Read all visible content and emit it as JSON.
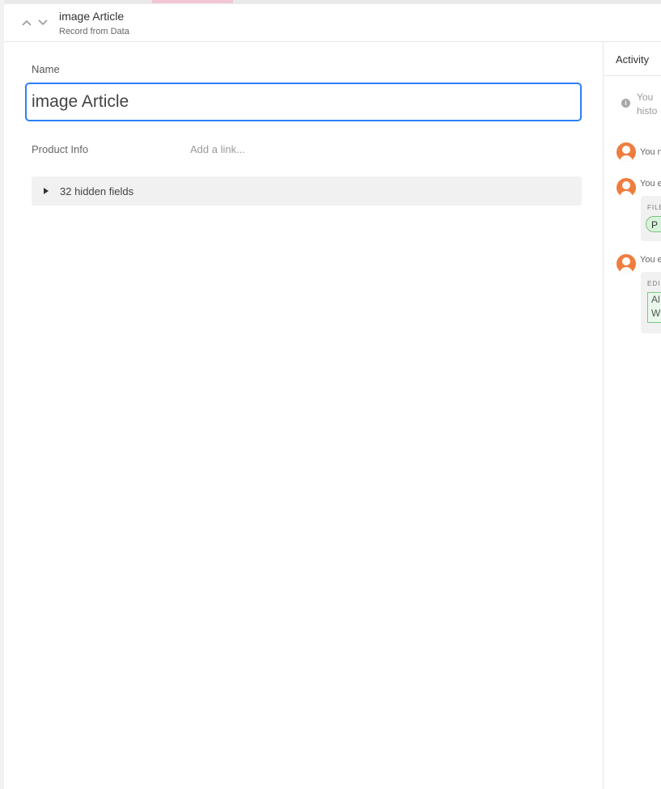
{
  "header": {
    "title": "image Article",
    "subtitle": "Record from Data"
  },
  "fields": {
    "name_label": "Name",
    "name_value": "image Article",
    "product_info_label": "Product Info",
    "product_info_placeholder": "Add a link...",
    "hidden_fields_label": "32 hidden fields"
  },
  "activity": {
    "title": "Activity",
    "info_text_line1": "You",
    "info_text_line2": "histo",
    "entries": [
      {
        "text": "You n"
      },
      {
        "text": "You e",
        "card_label": "FILE",
        "pill_text": "P"
      },
      {
        "text": "You e",
        "card_label": "EDI",
        "diff_line1": "Al",
        "diff_line2": "W"
      }
    ]
  },
  "colors": {
    "focus_border": "#2d7ff9",
    "avatar": "#ef7d3f",
    "added_green": "#79c37f"
  }
}
